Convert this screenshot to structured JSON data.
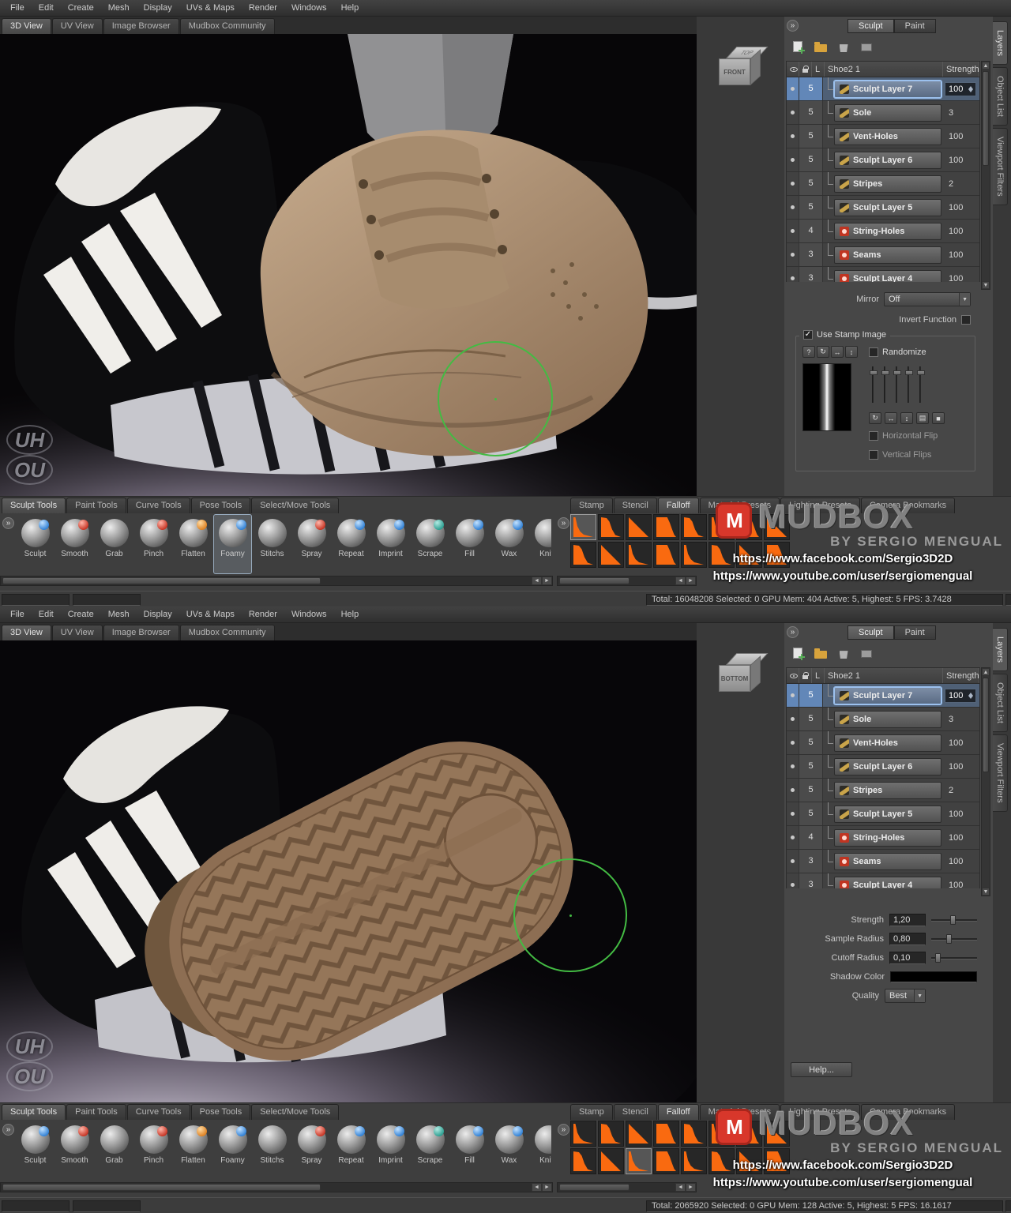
{
  "icons": {
    "expand": "»",
    "help": "?",
    "refresh": "↻",
    "swap_h": "↔",
    "swap_v": "↕",
    "grid": "▤",
    "square": "■",
    "dropdown_arrow": "▼",
    "scroll_left": "◄",
    "scroll_right": "►",
    "scroll_up": "▲",
    "scroll_down": "▼",
    "check": "✓",
    "logo_letter": "M"
  },
  "menu": {
    "items": [
      "File",
      "Edit",
      "Create",
      "Mesh",
      "Display",
      "UVs & Maps",
      "Render",
      "Windows",
      "Help"
    ]
  },
  "view_tabs": [
    {
      "label": "3D View",
      "active": true
    },
    {
      "label": "UV View"
    },
    {
      "label": "Image Browser"
    },
    {
      "label": "Mudbox Community"
    }
  ],
  "mode_tabs": [
    {
      "label": "Sculpt",
      "active": true
    },
    {
      "label": "Paint"
    }
  ],
  "side_tabs": [
    {
      "label": "Layers",
      "active": true
    },
    {
      "label": "Object List"
    },
    {
      "label": "Viewport Filters"
    }
  ],
  "layers": {
    "header": {
      "l": "L",
      "name": "Shoe2 1",
      "strength": "Strength"
    },
    "rows": [
      {
        "num": "5",
        "label": "Sculpt Layer 7",
        "value": "100",
        "selected": true
      },
      {
        "num": "5",
        "label": "Sole",
        "value": "3"
      },
      {
        "num": "5",
        "label": "Vent-Holes",
        "value": "100"
      },
      {
        "num": "5",
        "label": "Sculpt Layer 6",
        "value": "100"
      },
      {
        "num": "5",
        "label": "Stripes",
        "value": "2"
      },
      {
        "num": "5",
        "label": "Sculpt Layer 5",
        "value": "100"
      },
      {
        "num": "4",
        "label": "String-Holes",
        "value": "100",
        "red": true
      },
      {
        "num": "3",
        "label": "Seams",
        "value": "100",
        "red": true
      },
      {
        "num": "3",
        "label": "Sculpt Layer 4",
        "value": "100",
        "red": true
      }
    ]
  },
  "tool_tabs": [
    {
      "label": "Sculpt Tools",
      "active": true
    },
    {
      "label": "Paint Tools"
    },
    {
      "label": "Curve Tools"
    },
    {
      "label": "Pose Tools"
    },
    {
      "label": "Select/Move Tools"
    }
  ],
  "tools": [
    {
      "label": "Sculpt",
      "accent": "acc-blue"
    },
    {
      "label": "Smooth",
      "accent": "acc-red"
    },
    {
      "label": "Grab",
      "accent": "acc-gray"
    },
    {
      "label": "Pinch",
      "accent": "acc-red"
    },
    {
      "label": "Flatten",
      "accent": "acc-orange"
    },
    {
      "label": "Foamy",
      "accent": "acc-blue",
      "selected": true
    },
    {
      "label": "Stitchs",
      "accent": "acc-gray"
    },
    {
      "label": "Spray",
      "accent": "acc-red"
    },
    {
      "label": "Repeat",
      "accent": "acc-blue"
    },
    {
      "label": "Imprint",
      "accent": "acc-blue"
    },
    {
      "label": "Scrape",
      "accent": "acc-teal"
    },
    {
      "label": "Fill",
      "accent": "acc-blue"
    },
    {
      "label": "Wax",
      "accent": "acc-blue"
    },
    {
      "label": "Knife",
      "accent": "acc-gray"
    }
  ],
  "preset_tabs": [
    {
      "label": "Stamp"
    },
    {
      "label": "Stencil"
    },
    {
      "label": "Falloff",
      "active": true
    },
    {
      "label": "Material Presets"
    },
    {
      "label": "Lighting Presets"
    },
    {
      "label": "Camera Bookmarks"
    }
  ],
  "falloff_top": [
    {
      "shape": "f1",
      "selected": true
    },
    {
      "shape": "f2"
    },
    {
      "shape": "f3"
    },
    {
      "shape": "f4"
    },
    {
      "shape": "f2"
    },
    {
      "shape": "f1"
    },
    {
      "shape": "f4"
    },
    {
      "shape": "f3"
    },
    {
      "shape": "f2"
    },
    {
      "shape": "f3"
    },
    {
      "shape": "f1"
    },
    {
      "shape": "f4"
    },
    {
      "shape": "f1"
    },
    {
      "shape": "f2"
    },
    {
      "shape": "f3"
    },
    {
      "shape": "f4"
    }
  ],
  "falloff_bottom": [
    {
      "shape": "f1"
    },
    {
      "shape": "f2"
    },
    {
      "shape": "f3"
    },
    {
      "shape": "f4"
    },
    {
      "shape": "f2"
    },
    {
      "shape": "f1"
    },
    {
      "shape": "f4"
    },
    {
      "shape": "f3"
    },
    {
      "shape": "f2"
    },
    {
      "shape": "f3"
    },
    {
      "shape": "f1",
      "selected": true
    },
    {
      "shape": "f4"
    },
    {
      "shape": "f1"
    },
    {
      "shape": "f2"
    },
    {
      "shape": "f3"
    },
    {
      "shape": "f4"
    }
  ],
  "watermark": {
    "title": "MUDBOX",
    "byline": "BY SERGIO MENGUAL",
    "url_facebook": "https://www.facebook.com/Sergio3D2D",
    "url_youtube": "https://www.youtube.com/user/sergiomengual"
  },
  "viewport_watermark": {
    "line1": "UH",
    "line2": "OU"
  },
  "top_half": {
    "cube_top": "TOP",
    "cube_front": "FRONT",
    "mirror_label": "Mirror",
    "mirror_value": "Off",
    "invert_label": "Invert Function",
    "stamp": {
      "use_label": "Use Stamp Image",
      "randomize_label": "Randomize",
      "hflip_label": "Horizontal Flip",
      "vflip_label": "Vertical Flips"
    },
    "status": "Total: 16048208  Selected: 0 GPU Mem: 404  Active: 5, Highest: 5  FPS: 3.7428"
  },
  "bottom_half": {
    "cube_top": "",
    "cube_front": "BOTTOM",
    "props": {
      "strength": {
        "label": "Strength",
        "value": "1,20"
      },
      "sample_radius": {
        "label": "Sample Radius",
        "value": "0,80"
      },
      "cutoff_radius": {
        "label": "Cutoff Radius",
        "value": "0,10"
      },
      "shadow_color": {
        "label": "Shadow Color"
      },
      "quality": {
        "label": "Quality",
        "value": "Best"
      }
    },
    "help_label": "Help...",
    "status": "Total: 2065920  Selected: 0 GPU Mem: 128  Active: 5, Highest: 5  FPS: 16.1617"
  }
}
